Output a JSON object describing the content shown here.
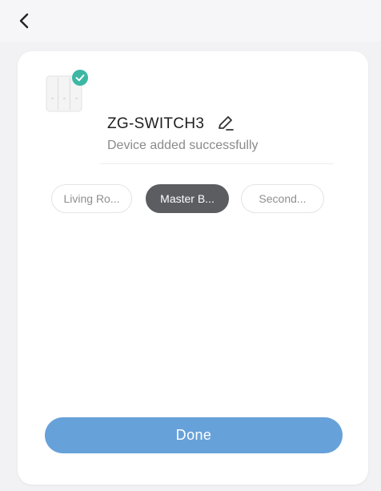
{
  "header": {
    "back_icon": "chevron-left-icon"
  },
  "device": {
    "image_icon": "wall-switch-icon",
    "status_icon": "check-circle-icon",
    "name": "ZG-SWITCH3",
    "edit_icon": "pencil-icon",
    "status": "Device added successfully"
  },
  "rooms": [
    {
      "label": "Living Ro...",
      "selected": false
    },
    {
      "label": "Master B...",
      "selected": true
    },
    {
      "label": "Second...",
      "selected": false
    }
  ],
  "footer": {
    "done_label": "Done"
  },
  "colors": {
    "accent": "#67a1da",
    "success": "#3bb7a4",
    "chip_selected": "#5b5d61"
  }
}
